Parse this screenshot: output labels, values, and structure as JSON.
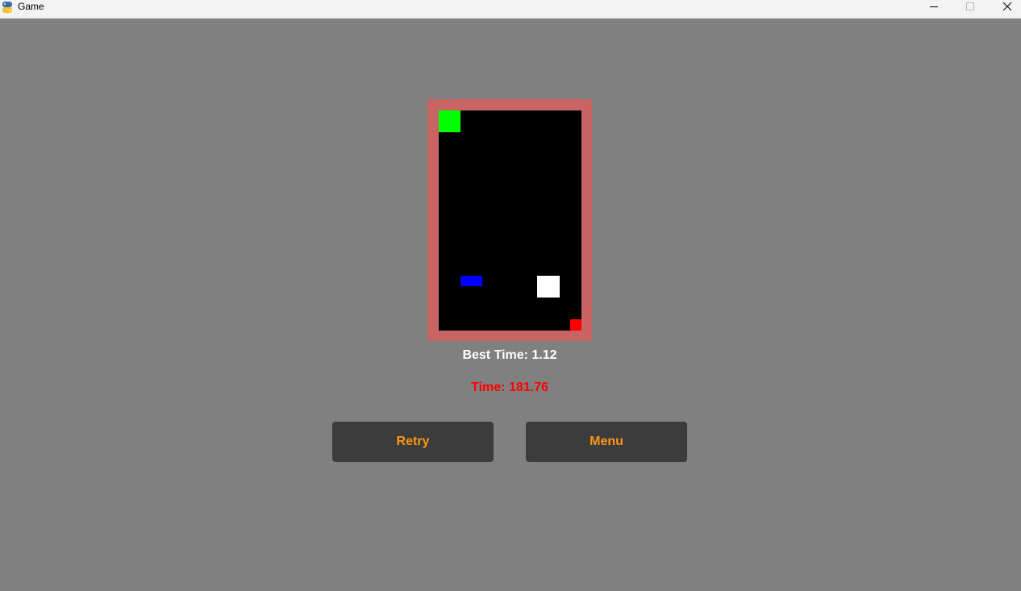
{
  "window": {
    "title": "Game",
    "icon": "python-icon"
  },
  "board": {
    "frame_color": "#c86464",
    "background_color": "#000000",
    "pieces": [
      {
        "name": "player-block",
        "color": "#00ff00"
      },
      {
        "name": "blue-block",
        "color": "#0000ff"
      },
      {
        "name": "white-block",
        "color": "#ffffff"
      },
      {
        "name": "goal-block",
        "color": "#ff0000"
      }
    ]
  },
  "stats": {
    "best_time": "Best Time: 1.12",
    "time": "Time: 181.76",
    "time_color": "#ff0000"
  },
  "buttons": {
    "retry": "Retry",
    "menu": "Menu",
    "text_color": "#ff9614",
    "background_color": "#3c3c3c"
  }
}
